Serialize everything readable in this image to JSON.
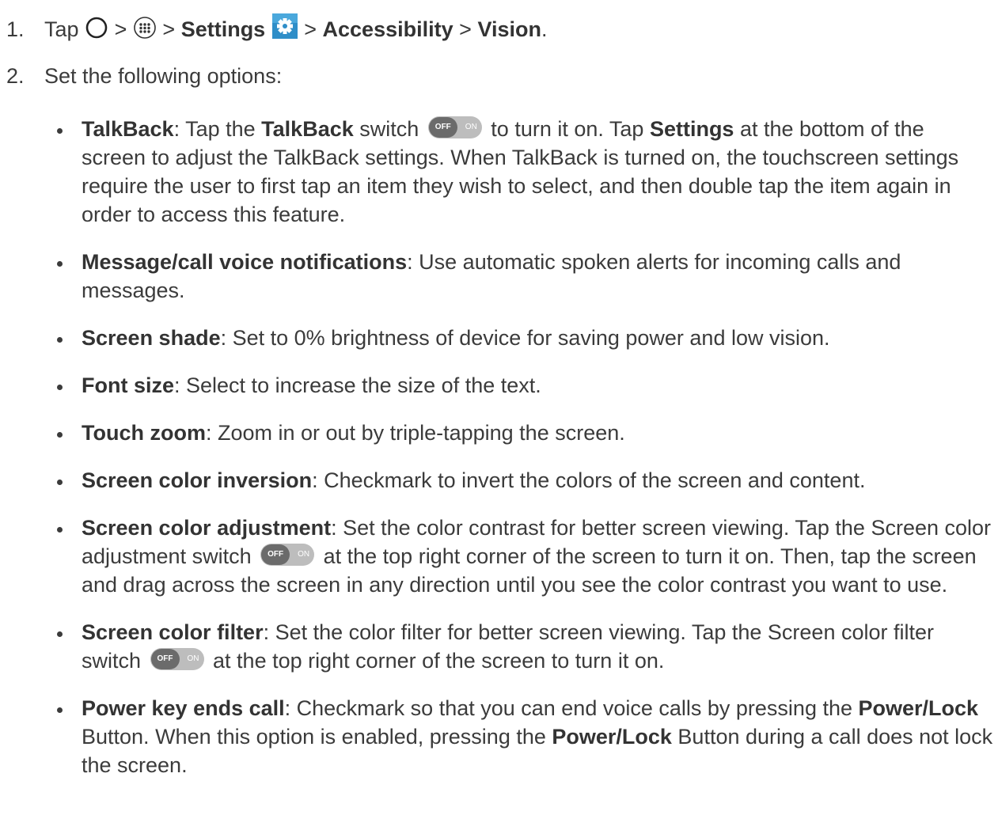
{
  "step1": {
    "number": "1.",
    "tap": "Tap",
    "sep": ">",
    "settings": "Settings",
    "accessibility": "Accessibility",
    "vision": "Vision",
    "end": ".",
    "icons": [
      "home-circle-icon",
      "apps-icon",
      "settings-gear-icon"
    ]
  },
  "step2": {
    "number": "2.",
    "text": "Set the following options:"
  },
  "toggle": {
    "off": "OFF",
    "on": "ON"
  },
  "items": [
    {
      "term": "TalkBack",
      "p1": ": Tap the ",
      "b1": "TalkBack",
      "p2": " switch",
      "p3": " to turn it on. Tap ",
      "b2": "Settings",
      "p4": " at the bottom of the screen to adjust the TalkBack settings. When TalkBack is turned on, the touchscreen settings require the user to first tap an item they wish to select, and then double tap the item again in order to access this feature."
    },
    {
      "term": "Message/call voice notifications",
      "desc": ": Use automatic spoken alerts for incoming calls and messages."
    },
    {
      "term": "Screen shade",
      "desc": ": Set to 0% brightness of device for saving power and low vision."
    },
    {
      "term": "Font size",
      "desc": ": Select to increase the size of the text."
    },
    {
      "term": "Touch zoom",
      "desc": ": Zoom in or out by triple-tapping the screen."
    },
    {
      "term": "Screen color inversion",
      "desc": ": Checkmark to invert the colors of the screen and content."
    },
    {
      "term": "Screen color adjustment",
      "p1": ": Set the color contrast for better screen viewing. Tap the Screen color adjustment switch",
      "p2": " at the top right corner of the screen to turn it on. Then, tap the screen and drag across the screen in any direction until you see the color contrast you want to use."
    },
    {
      "term": "Screen color filter",
      "p1": ": Set the color filter for better screen viewing. Tap the Screen color filter switch",
      "p2": " at the top right corner of the screen to turn it on."
    },
    {
      "term": "Power key ends call",
      "p1": ": Checkmark so that you can end voice calls by pressing the ",
      "b1": "Power/Lock",
      "p2": " Button. When this option is enabled, pressing the ",
      "b2": "Power/Lock",
      "p3": " Button during a call does not lock the screen."
    }
  ]
}
